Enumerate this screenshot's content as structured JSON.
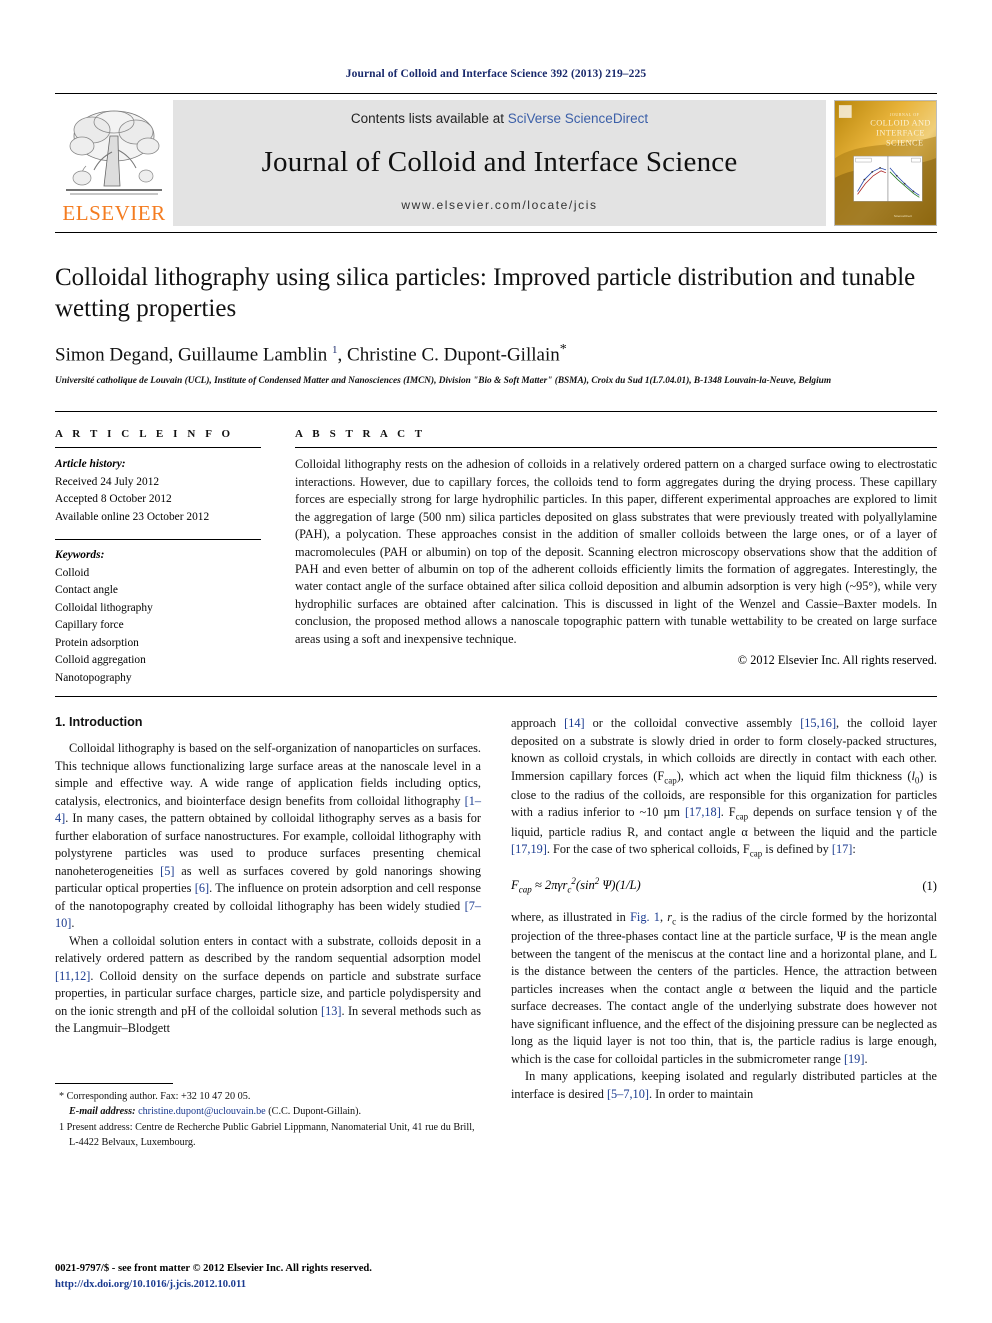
{
  "running_head": "Journal of Colloid and Interface Science 392 (2013) 219–225",
  "masthead": {
    "contents_prefix": "Contents lists available at ",
    "sciencedirect_link": "SciVerse ScienceDirect",
    "journal_title": "Journal of Colloid and Interface Science",
    "journal_url": "www.elsevier.com/locate/jcis",
    "publisher_wordmark": "ELSEVIER",
    "cover_title_lines": [
      "JOURNAL OF",
      "COLLOID AND",
      "INTERFACE",
      "SCIENCE"
    ]
  },
  "article": {
    "title": "Colloidal lithography using silica particles: Improved particle distribution and tunable wetting properties",
    "authors_html": "Simon Degand, Guillaume Lamblin <sup>1</sup>, Christine C. Dupont-Gillain<span class=\"star\">*</span>",
    "affiliation": "Université catholique de Louvain (UCL), Institute of Condensed Matter and Nanosciences (IMCN), Division \"Bio &amp; Soft Matter\" (BSMA), Croix du Sud 1(L7.04.01), B-1348 Louvain-la-Neuve, Belgium"
  },
  "info": {
    "heading": "A R T I C L E   I N F O",
    "history_label": "Article history:",
    "history": [
      "Received 24 July 2012",
      "Accepted 8 October 2012",
      "Available online 23 October 2012"
    ],
    "keywords_label": "Keywords:",
    "keywords": [
      "Colloid",
      "Contact angle",
      "Colloidal lithography",
      "Capillary force",
      "Protein adsorption",
      "Colloid aggregation",
      "Nanotopography"
    ]
  },
  "abstract": {
    "heading": "A B S T R A C T",
    "text": "Colloidal lithography rests on the adhesion of colloids in a relatively ordered pattern on a charged surface owing to electrostatic interactions. However, due to capillary forces, the colloids tend to form aggregates during the drying process. These capillary forces are especially strong for large hydrophilic particles. In this paper, different experimental approaches are explored to limit the aggregation of large (500 nm) silica particles deposited on glass substrates that were previously treated with polyallylamine (PAH), a polycation. These approaches consist in the addition of smaller colloids between the large ones, or of a layer of macromolecules (PAH or albumin) on top of the deposit. Scanning electron microscopy observations show that the addition of PAH and even better of albumin on top of the adherent colloids efficiently limits the formation of aggregates. Interestingly, the water contact angle of the surface obtained after silica colloid deposition and albumin adsorption is very high (~95°), while very hydrophilic surfaces are obtained after calcination. This is discussed in light of the Wenzel and Cassie–Baxter models. In conclusion, the proposed method allows a nanoscale topographic pattern with tunable wettability to be created on large surface areas using a soft and inexpensive technique.",
    "copyright": "© 2012 Elsevier Inc. All rights reserved."
  },
  "body": {
    "section_title": "1. Introduction",
    "left_paragraphs": [
      "Colloidal lithography is based on the self-organization of nanoparticles on surfaces. This technique allows functionalizing large surface areas at the nanoscale level in a simple and effective way. A wide range of application fields including optics, catalysis, electronics, and biointerface design benefits from colloidal lithography [1–4]. In many cases, the pattern obtained by colloidal lithography serves as a basis for further elaboration of surface nanostructures. For example, colloidal lithography with polystyrene particles was used to produce surfaces presenting chemical nanoheterogeneities [5] as well as surfaces covered by gold nanorings showing particular optical properties [6]. The influence on protein adsorption and cell response of the nanotopography created by colloidal lithography has been widely studied [7–10].",
      "When a colloidal solution enters in contact with a substrate, colloids deposit in a relatively ordered pattern as described by the random sequential adsorption model [11,12]. Colloid density on the surface depends on particle and substrate surface properties, in particular surface charges, particle size, and particle polydispersity and on the ionic strength and pH of the colloidal solution [13]. In several methods such as the Langmuir–Blodgett"
    ],
    "right_paragraph_1": "approach [14] or the colloidal convective assembly [15,16], the colloid layer deposited on a substrate is slowly dried in order to form closely-packed structures, known as colloid crystals, in which colloids are directly in contact with each other. Immersion capillary forces (Fcap), which act when the liquid film thickness (l0) is close to the radius of the colloids, are responsible for this organization for particles with a radius inferior to ~10 µm [17,18]. Fcap depends on surface tension γ of the liquid, particle radius R, and contact angle α between the liquid and the particle [17,19]. For the case of two spherical colloids, Fcap is defined by [17]:",
    "equation_number": "(1)",
    "right_paragraph_2": "where, as illustrated in Fig. 1, rc is the radius of the circle formed by the horizontal projection of the three-phases contact line at the particle surface, Ψ is the mean angle between the tangent of the meniscus at the contact line and a horizontal plane, and L is the distance between the centers of the particles. Hence, the attraction between particles increases when the contact angle α between the liquid and the particle surface decreases. The contact angle of the underlying substrate does however not have significant influence, and the effect of the disjoining pressure can be neglected as long as the liquid layer is not too thin, that is, the particle radius is large enough, which is the case for colloidal particles in the submicrometer range [19].",
    "right_paragraph_3": "In many applications, keeping isolated and regularly distributed particles at the interface is desired [5–7,10]. In order to maintain"
  },
  "footnotes": {
    "corresponding": "* Corresponding author. Fax: +32 10 47 20 05.",
    "email_label": "E-mail address:",
    "email": "christine.dupont@uclouvain.be",
    "email_suffix": "(C.C. Dupont-Gillain).",
    "present_address": "1 Present address: Centre de Recherche Public Gabriel Lippmann, Nanomaterial Unit, 41 rue du Brill, L-4422 Belvaux, Luxembourg."
  },
  "footer": {
    "issn_line": "0021-9797/$ - see front matter © 2012 Elsevier Inc. All rights reserved.",
    "doi": "http://dx.doi.org/10.1016/j.jcis.2012.10.011"
  },
  "colors": {
    "link_blue": "#1a3a8f",
    "elsevier_orange": "#f47c20",
    "masthead_gray": "#e3e3e3"
  }
}
